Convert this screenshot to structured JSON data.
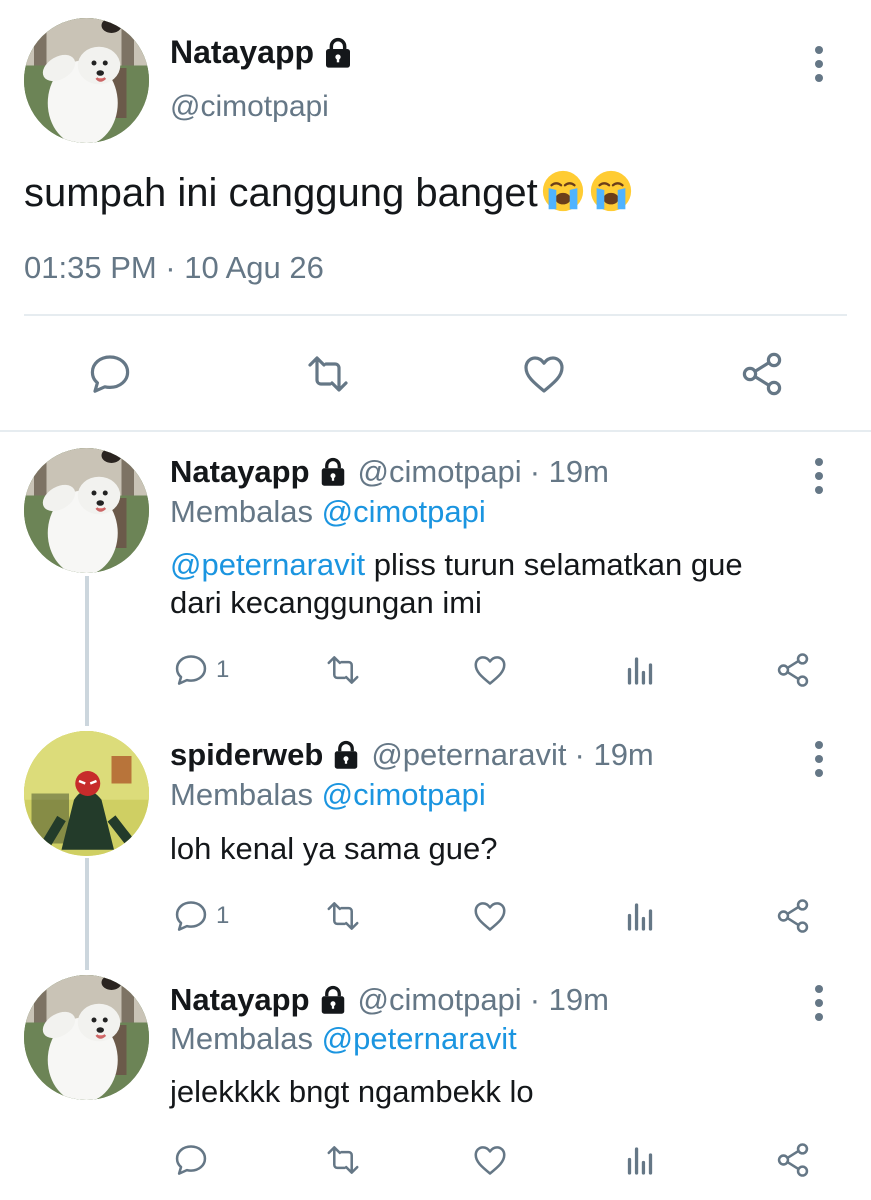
{
  "main_tweet": {
    "name": "Natayapp",
    "handle": "@cimotpapi",
    "text": "sumpah ini canggung banget",
    "emoji": [
      "😭",
      "😭"
    ],
    "timestamp": "01:35 PM · 10 Agu 26"
  },
  "replies": [
    {
      "name": "Natayapp",
      "handle": "@cimotpapi",
      "time": "· 19m",
      "replying_label": "Membalas",
      "replying_to": "@cimotpapi",
      "mention": "@peternaravit",
      "text_line1": " pliss turun selamatkan gue",
      "text_line2": "dari kecanggungan imi",
      "reply_count": "1"
    },
    {
      "name": "spiderweb",
      "handle": "@peternaravit",
      "time": "· 19m",
      "replying_label": "Membalas",
      "replying_to": "@cimotpapi",
      "text": "loh kenal ya sama gue?",
      "reply_count": "1"
    },
    {
      "name": "Natayapp",
      "handle": "@cimotpapi",
      "time": "· 19m",
      "replying_label": "Membalas",
      "replying_to": "@peternaravit",
      "text": "jelekkkk bngt ngambekk lo"
    }
  ],
  "colors": {
    "text": "#14171a",
    "secondary": "#657786",
    "link": "#1b95e0",
    "divider": "#e6ecf0"
  }
}
